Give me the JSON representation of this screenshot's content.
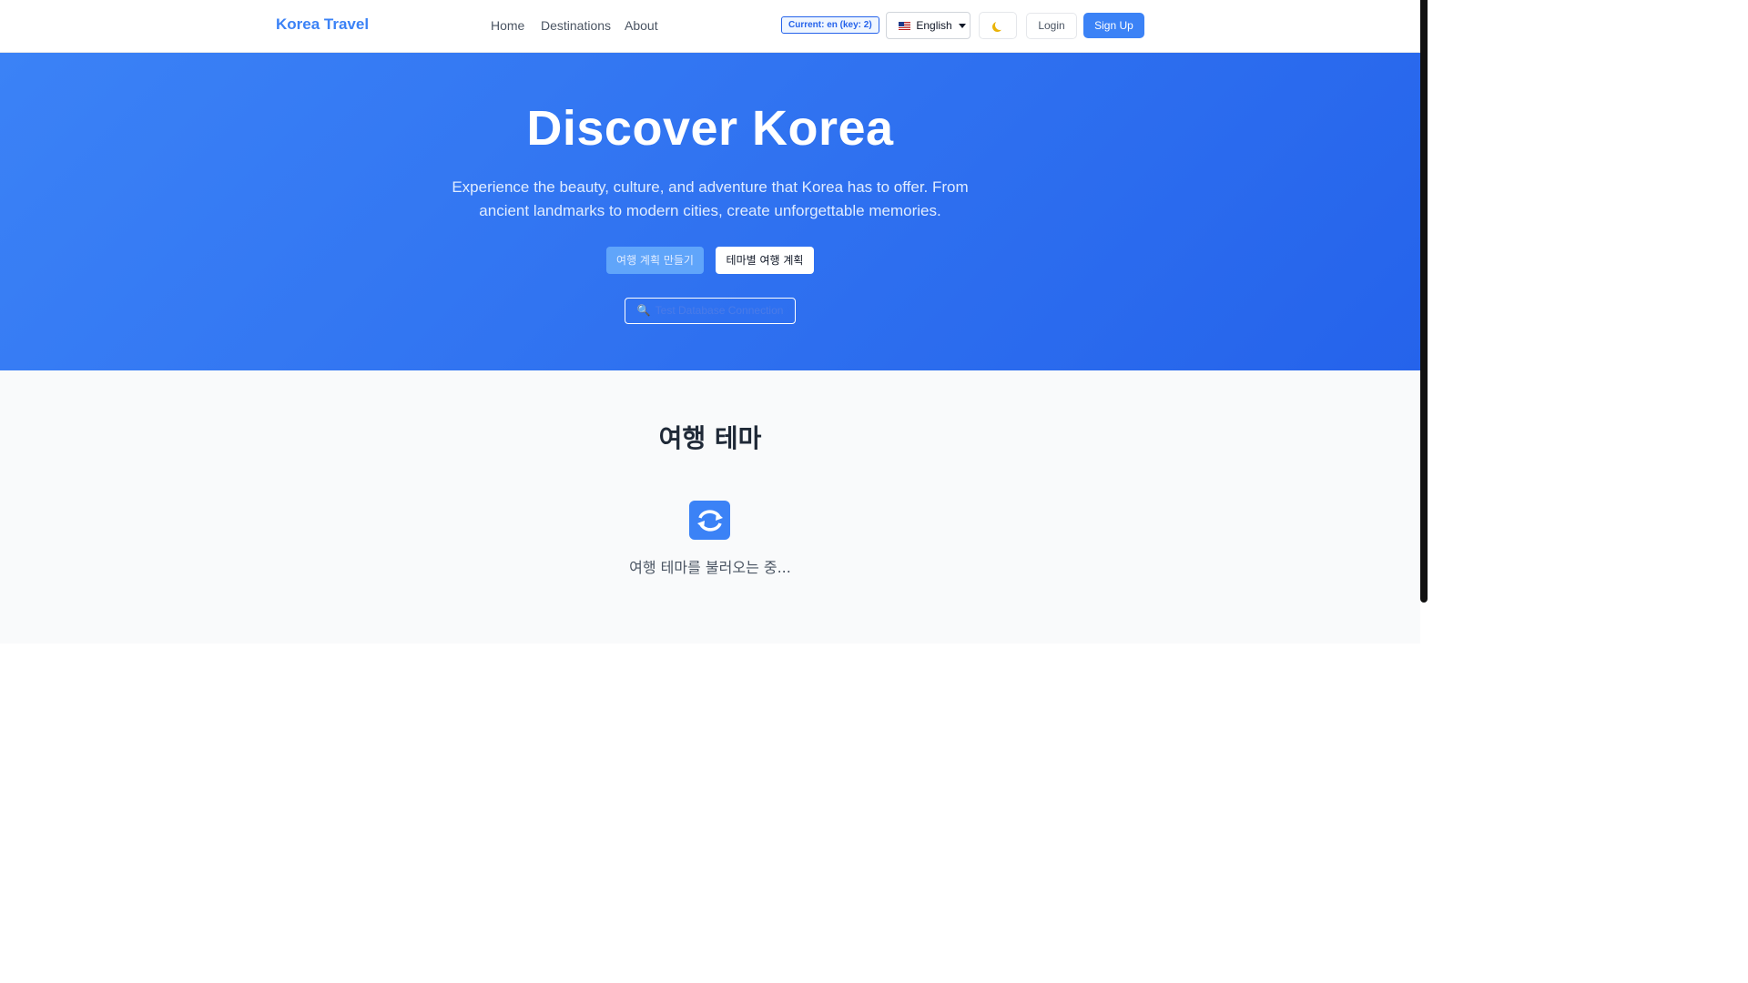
{
  "header": {
    "brand": "Korea Travel",
    "nav": [
      "Home",
      "Destinations",
      "About"
    ],
    "current_badge": "Current: en (key: 2)",
    "language": "English",
    "language_icon": "us-flag-icon",
    "theme_icon": "moon-icon",
    "login_label": "Login",
    "signup_label": "Sign Up"
  },
  "hero": {
    "title": "Discover Korea",
    "description": "Experience the beauty, culture, and adventure that Korea has to offer. From ancient landmarks to modern cities, create unforgettable memories.",
    "plan_button": "여행 계획 만들기",
    "theme_plan_button": "테마별 여행 계획",
    "db_test_icon": "magnifier-icon",
    "db_test_button": "Test Database Connection"
  },
  "themes": {
    "title": "여행 테마",
    "loading_icon": "refresh-icon",
    "loading_text": "여행 테마를 불러오는 중..."
  },
  "colors": {
    "accent": "#3b82f6",
    "hero_gradient_start": "#3b82f6",
    "hero_gradient_end": "#2563eb"
  }
}
